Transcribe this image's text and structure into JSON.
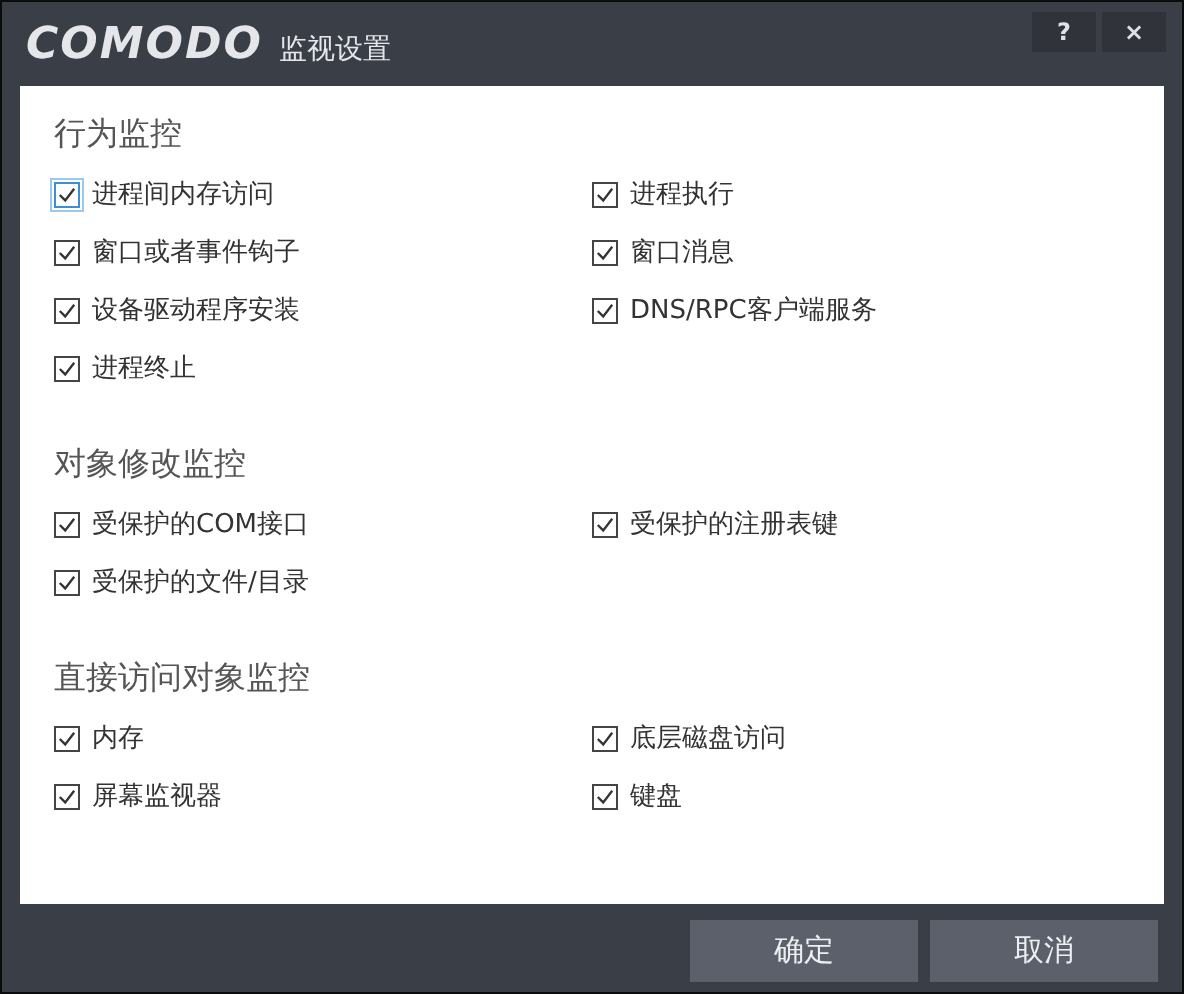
{
  "window": {
    "logo": "COMODO",
    "title": "监视设置",
    "controls": [
      "?",
      "×"
    ]
  },
  "sections": [
    {
      "heading": "行为监控",
      "items": [
        {
          "label": "进程间内存访问",
          "checked": true,
          "focused": true
        },
        {
          "label": "进程执行",
          "checked": true,
          "focused": false
        },
        {
          "label": "窗口或者事件钩子",
          "checked": true,
          "focused": false
        },
        {
          "label": "窗口消息",
          "checked": true,
          "focused": false
        },
        {
          "label": "设备驱动程序安装",
          "checked": true,
          "focused": false
        },
        {
          "label": "DNS/RPC客户端服务",
          "checked": true,
          "focused": false
        },
        {
          "label": "进程终止",
          "checked": true,
          "focused": false
        }
      ]
    },
    {
      "heading": "对象修改监控",
      "items": [
        {
          "label": "受保护的COM接口",
          "checked": true,
          "focused": false
        },
        {
          "label": "受保护的注册表键",
          "checked": true,
          "focused": false
        },
        {
          "label": "受保护的文件/目录",
          "checked": true,
          "focused": false
        }
      ]
    },
    {
      "heading": "直接访问对象监控",
      "items": [
        {
          "label": "内存",
          "checked": true,
          "focused": false
        },
        {
          "label": "底层磁盘访问",
          "checked": true,
          "focused": false
        },
        {
          "label": "屏幕监视器",
          "checked": true,
          "focused": false
        },
        {
          "label": "键盘",
          "checked": true,
          "focused": false
        }
      ]
    }
  ],
  "buttons": [
    "确定",
    "取消"
  ]
}
